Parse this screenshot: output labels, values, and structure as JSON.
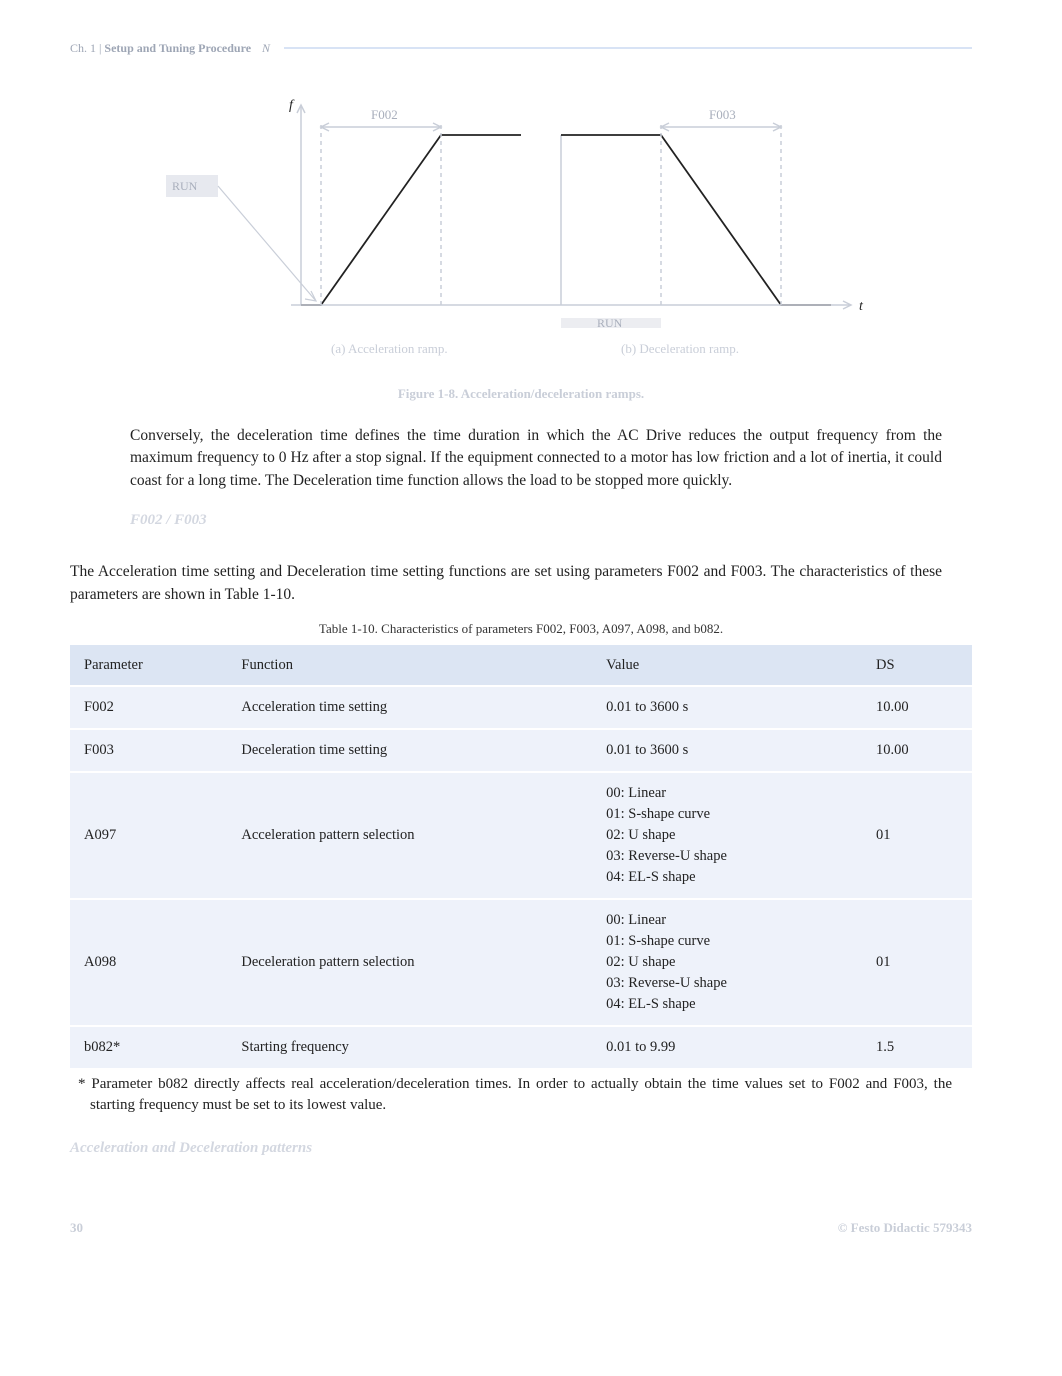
{
  "header": {
    "section": "Ch. 1 |",
    "title": "Setup and Tuning Procedure",
    "suffix": "N"
  },
  "figure": {
    "ylabel": "f",
    "run_left": "RUN",
    "run_right": "RUN",
    "xlabel": "t",
    "f002_label": "F002",
    "f003_label": "F003",
    "accel_caption": "(a) Acceleration ramp.",
    "decel_caption": "(b) Deceleration ramp.",
    "caption": "Figure 1-8. Acceleration/deceleration ramps."
  },
  "paragraphs": {
    "p1": "Conversely, the deceleration time defines the time duration in which the AC Drive reduces the output frequency from the maximum frequency to 0 Hz after a stop signal. If the equipment connected to a motor has low friction and a lot of inertia, it could coast for a long time. The Deceleration time function allows the load to be stopped more quickly.",
    "sub1": "F002 / F003",
    "p2": "The Acceleration time setting and Deceleration time setting functions are set using parameters F002 and F003. The characteristics of these parameters are shown in Table 1-10.",
    "table_caption": "Table 1-10. Characteristics of parameters F002, F003, A097, A098, and b082.",
    "footnote": "* Parameter b082 directly affects real acceleration/deceleration times. In order to actually obtain the time values set to F002 and F003, the starting frequency must be set to its lowest value.",
    "sub2": "Acceleration and Deceleration patterns"
  },
  "table": {
    "headers": {
      "c1": "Parameter",
      "c2": "Function",
      "c3": "Value",
      "c4": "DS"
    },
    "rows": [
      {
        "p": "F002",
        "f": "Acceleration time setting",
        "v": "0.01 to 3600 s",
        "d": "10.00"
      },
      {
        "p": "F003",
        "f": "Deceleration time setting",
        "v": "0.01 to 3600 s",
        "d": "10.00"
      },
      {
        "p": "A097",
        "f": "Acceleration pattern selection",
        "v": "00: Linear\n01: S-shape curve\n02: U shape\n03: Reverse-U shape\n04: EL-S shape",
        "d": "01"
      },
      {
        "p": "A098",
        "f": "Deceleration pattern selection",
        "v": "00: Linear\n01: S-shape curve\n02: U shape\n03: Reverse-U shape\n04: EL-S shape",
        "d": "01"
      },
      {
        "p": "b082*",
        "f": "Starting frequency",
        "v": "0.01 to 9.99",
        "d": "1.5"
      }
    ]
  },
  "footer": {
    "page": "30",
    "right": "© Festo Didactic 579343"
  },
  "chart_data": [
    {
      "type": "line",
      "title": "Acceleration ramp",
      "xlabel": "t",
      "ylabel": "f",
      "annotations": [
        "RUN",
        "F002"
      ],
      "description": "Output frequency rises linearly from 0 to maximum over duration F002 after RUN command, then stays constant."
    },
    {
      "type": "line",
      "title": "Deceleration ramp",
      "xlabel": "t",
      "ylabel": "f",
      "annotations": [
        "RUN",
        "F003"
      ],
      "description": "Output frequency holds at maximum while RUN is asserted, then falls linearly to 0 over duration F003 after stop."
    }
  ]
}
